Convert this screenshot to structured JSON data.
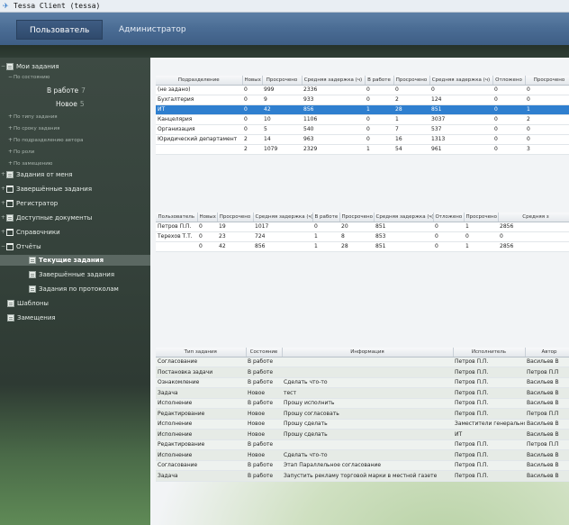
{
  "window": {
    "title": "Tessa Client (tessa)"
  },
  "tabs": [
    {
      "label": "Пользователь",
      "active": true
    },
    {
      "label": "Администратор",
      "active": false
    }
  ],
  "sidebar": {
    "my_tasks": "Мои задания",
    "by_state": "По состоянию",
    "state_in_work": {
      "label": "В работе",
      "count": "7"
    },
    "state_new": {
      "label": "Новое",
      "count": "5"
    },
    "by_type": "По типу задания",
    "by_deadline": "По сроку задания",
    "by_author_dept": "По подразделению автора",
    "by_role": "По роли",
    "by_deputy": "По замещению",
    "from_me": "Задания от меня",
    "completed": "Завершённые задания",
    "registrar": "Регистратор",
    "available_docs": "Доступные документы",
    "directories": "Справочники",
    "reports": "Отчёты",
    "current_tasks": "Текущие задания",
    "completed_tasks": "Завершённые задания",
    "tasks_by_protocols": "Задания по протоколам",
    "templates": "Шаблоны",
    "deputies": "Замещения"
  },
  "dept_table": {
    "columns": [
      "Подразделение",
      "Новых",
      "Просрочено",
      "Средняя задержка (ч)",
      "В работе",
      "Просрочено",
      "Средняя задержка (ч)",
      "Отложено",
      "Просрочено"
    ],
    "rows": [
      [
        "(не задано)",
        "0",
        "999",
        "2336",
        "0",
        "0",
        "0",
        "0",
        "0"
      ],
      [
        "Бухгалтерия",
        "0",
        "9",
        "933",
        "0",
        "2",
        "124",
        "0",
        "0"
      ],
      [
        "ИТ",
        "0",
        "42",
        "856",
        "1",
        "28",
        "851",
        "0",
        "1"
      ],
      [
        "Канцелярия",
        "0",
        "10",
        "1106",
        "0",
        "1",
        "3037",
        "0",
        "2"
      ],
      [
        "Организация",
        "0",
        "5",
        "540",
        "0",
        "7",
        "537",
        "0",
        "0"
      ],
      [
        "Юридический департамент",
        "2",
        "14",
        "963",
        "0",
        "16",
        "1313",
        "0",
        "0"
      ],
      [
        "",
        "2",
        "1079",
        "2329",
        "1",
        "54",
        "961",
        "0",
        "3"
      ]
    ],
    "selected_row": 2
  },
  "user_table": {
    "columns": [
      "Пользователь",
      "Новых",
      "Просрочено",
      "Средняя задержка (ч)",
      "В работе",
      "Просрочено",
      "Средняя задержка (ч)",
      "Отложено",
      "Просрочено",
      "Средняя з"
    ],
    "rows": [
      [
        "Петров П.П.",
        "0",
        "19",
        "1017",
        "0",
        "20",
        "851",
        "0",
        "1",
        "2856"
      ],
      [
        "Терехов Т.Т.",
        "0",
        "23",
        "724",
        "1",
        "8",
        "853",
        "0",
        "0",
        "0"
      ],
      [
        "",
        "0",
        "42",
        "856",
        "1",
        "28",
        "851",
        "0",
        "1",
        "2856"
      ]
    ]
  },
  "task_table": {
    "columns": [
      "Тип задания",
      "Состояние",
      "Информация",
      "Исполнитель",
      "Автор"
    ],
    "rows": [
      [
        "Согласование",
        "В работе",
        "",
        "Петров П.П.",
        "Васильев В"
      ],
      [
        "Постановка задачи",
        "В работе",
        "",
        "Петров П.П.",
        "Петров П.П"
      ],
      [
        "Ознакомление",
        "В работе",
        "Сделать что-то",
        "Петров П.П.",
        "Васильев В"
      ],
      [
        "Задача",
        "Новое",
        "тест",
        "Петров П.П.",
        "Васильев В"
      ],
      [
        "Исполнение",
        "В работе",
        "Прошу исполнить",
        "Петров П.П.",
        "Васильев В"
      ],
      [
        "Редактирование",
        "Новое",
        "Прошу согласовать",
        "Петров П.П.",
        "Петров П.П"
      ],
      [
        "Исполнение",
        "Новое",
        "Прошу сделать",
        "Заместители генерального",
        "Васильев В"
      ],
      [
        "Исполнение",
        "Новое",
        "Прошу сделать",
        "ИТ",
        "Васильев В"
      ],
      [
        "Редактирование",
        "В работе",
        "",
        "Петров П.П.",
        "Петров П.П"
      ],
      [
        "Исполнение",
        "Новое",
        "Сделать что-то",
        "Петров П.П.",
        "Васильев В"
      ],
      [
        "Согласование",
        "В работе",
        "Этап Параллельное согласование",
        "Петров П.П.",
        "Васильев В"
      ],
      [
        "Задача",
        "В работе",
        "Запустить рекламу торговой марки в местной газете",
        "Петров П.П.",
        "Васильев В"
      ]
    ]
  }
}
